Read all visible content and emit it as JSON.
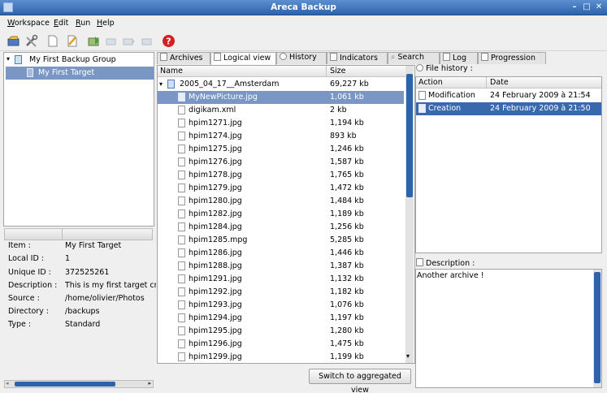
{
  "window": {
    "title": "Areca Backup",
    "controls": [
      "–",
      "□",
      "✕"
    ]
  },
  "menu": [
    {
      "label": "Workspace",
      "accel": "W",
      "rest": "orkspace"
    },
    {
      "label": "Edit",
      "accel": "E",
      "rest": "dit"
    },
    {
      "label": "Run",
      "accel": "R",
      "rest": "un"
    },
    {
      "label": "Help",
      "accel": "H",
      "rest": "elp"
    }
  ],
  "toolbar_icons": [
    "open-workspace-icon",
    "tools-icon",
    "new-target-icon",
    "edit-target-icon",
    "backup-icon",
    "merge-icon",
    "recover-icon",
    "delete-archive-icon",
    "help-icon"
  ],
  "tree": {
    "group": "My First Backup Group",
    "target": "My First Target"
  },
  "properties": [
    {
      "key": "Item :",
      "value": "My First Target"
    },
    {
      "key": "Local ID :",
      "value": "1"
    },
    {
      "key": "Unique ID :",
      "value": "372525261"
    },
    {
      "key": "Description :",
      "value": "This is my first target cre"
    },
    {
      "key": "Source :",
      "value": "/home/olivier/Photos"
    },
    {
      "key": "Directory :",
      "value": "/backups"
    },
    {
      "key": "Type :",
      "value": "Standard"
    }
  ],
  "tabs": [
    "Archives",
    "Logical view",
    "History",
    "Indicators",
    "Search",
    "Log",
    "Progression"
  ],
  "active_tab": "Logical view",
  "files": {
    "columns": {
      "name": "Name",
      "size": "Size"
    },
    "folder": {
      "name": "2005_04_17__Amsterdam",
      "size": "69,227 kb"
    },
    "rows": [
      {
        "name": "MyNewPicture.jpg",
        "size": "1,061 kb"
      },
      {
        "name": "digikam.xml",
        "size": "2 kb"
      },
      {
        "name": "hpim1271.jpg",
        "size": "1,194 kb"
      },
      {
        "name": "hpim1274.jpg",
        "size": "893 kb"
      },
      {
        "name": "hpim1275.jpg",
        "size": "1,246 kb"
      },
      {
        "name": "hpim1276.jpg",
        "size": "1,587 kb"
      },
      {
        "name": "hpim1278.jpg",
        "size": "1,765 kb"
      },
      {
        "name": "hpim1279.jpg",
        "size": "1,472 kb"
      },
      {
        "name": "hpim1280.jpg",
        "size": "1,484 kb"
      },
      {
        "name": "hpim1282.jpg",
        "size": "1,189 kb"
      },
      {
        "name": "hpim1284.jpg",
        "size": "1,256 kb"
      },
      {
        "name": "hpim1285.mpg",
        "size": "5,285 kb"
      },
      {
        "name": "hpim1286.jpg",
        "size": "1,446 kb"
      },
      {
        "name": "hpim1288.jpg",
        "size": "1,387 kb"
      },
      {
        "name": "hpim1291.jpg",
        "size": "1,132 kb"
      },
      {
        "name": "hpim1292.jpg",
        "size": "1,182 kb"
      },
      {
        "name": "hpim1293.jpg",
        "size": "1,076 kb"
      },
      {
        "name": "hpim1294.jpg",
        "size": "1,197 kb"
      },
      {
        "name": "hpim1295.jpg",
        "size": "1,280 kb"
      },
      {
        "name": "hpim1296.jpg",
        "size": "1,475 kb"
      },
      {
        "name": "hpim1299.jpg",
        "size": "1,199 kb"
      }
    ],
    "selected_index": 0,
    "switch_button": "Switch to aggregated view"
  },
  "history": {
    "label": "File history :",
    "columns": {
      "action": "Action",
      "date": "Date"
    },
    "rows": [
      {
        "action": "Modification",
        "date": "24 February 2009 à 21:54"
      },
      {
        "action": "Creation",
        "date": "24 February 2009 à 21:50"
      }
    ],
    "selected_index": 1
  },
  "description": {
    "label": "Description :",
    "text": "Another archive !"
  },
  "colors": {
    "title_bar": "#2d63aa",
    "selection": "#7a96c4",
    "history_selection": "#3a68ad",
    "help_red": "#d42020"
  }
}
